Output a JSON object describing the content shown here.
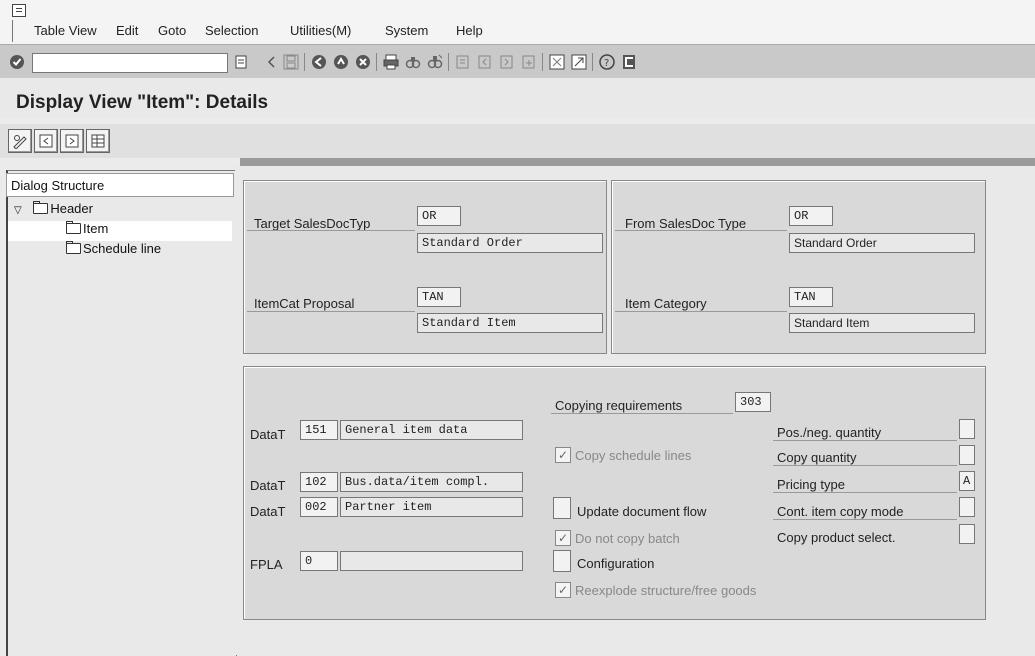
{
  "menubar": {
    "items": [
      {
        "label": "Table View",
        "u": "",
        "rest": ""
      },
      {
        "label": "Edit",
        "u": "",
        "rest": ""
      },
      {
        "label": "Goto",
        "u": "",
        "rest": ""
      },
      {
        "label": "Selection",
        "u": "",
        "rest": ""
      },
      {
        "label": "Utilities(M)",
        "u": "",
        "rest": ""
      },
      {
        "label": "System",
        "u": "",
        "rest": ""
      },
      {
        "label": "Help",
        "u": "",
        "rest": ""
      }
    ]
  },
  "toolbar": {
    "command_value": "",
    "icons": [
      "enter-icon",
      "save-icon",
      "back-icon",
      "exit-icon",
      "cancel-icon",
      "print-icon",
      "find-icon",
      "find-next-icon",
      "first-page-icon",
      "previous-page-icon",
      "next-page-icon",
      "last-page-icon",
      "create-session-icon",
      "shortcut-icon",
      "help-icon",
      "layout-menu-icon"
    ]
  },
  "page": {
    "title": "Display View \"Item\": Details"
  },
  "tree": {
    "heading": "Dialog Structure",
    "items": [
      {
        "label": "Header",
        "expanded": true
      },
      {
        "label": "Item",
        "selected": true
      },
      {
        "label": "Schedule line"
      }
    ]
  },
  "header_group": {
    "left": {
      "target_label": "Target SalesDocTyp",
      "target_value": "OR",
      "target_desc": "Standard Order",
      "proposal_label": "ItemCat Proposal",
      "proposal_value": "TAN",
      "proposal_desc": "Standard Item"
    },
    "right": {
      "from_label": "From SalesDoc Type",
      "from_value": "OR",
      "from_desc": "Standard Order",
      "category_label": "Item Category",
      "category_value": "TAN",
      "category_desc": "Standard Item"
    }
  },
  "copy_group": {
    "copying_req_label": "Copying requirements",
    "copying_req_value": "303",
    "data_rows": [
      {
        "label": "DataT",
        "code": "151",
        "desc": "General item data"
      },
      {
        "label": "DataT",
        "code": "102",
        "desc": "Bus.data/item compl."
      },
      {
        "label": "DataT",
        "code": "002",
        "desc": "Partner item"
      }
    ],
    "fpla_label": "FPLA",
    "fpla_value": "0",
    "fpla_desc": "",
    "checkboxes": [
      {
        "label": "Copy schedule lines",
        "checked": true,
        "enabled": false
      },
      {
        "label": "Update document flow",
        "checked": false,
        "enabled": true
      },
      {
        "label": "Do not copy batch",
        "checked": true,
        "enabled": false
      },
      {
        "label": "Configuration",
        "checked": false,
        "enabled": true
      },
      {
        "label": "Reexplode structure/free goods",
        "checked": true,
        "enabled": false
      }
    ],
    "right_fields": [
      {
        "label": "Pos./neg. quantity",
        "value": ""
      },
      {
        "label": "Copy quantity",
        "value": ""
      },
      {
        "label": "Pricing type",
        "value": "A"
      },
      {
        "label": "Cont. item copy mode",
        "value": ""
      },
      {
        "label": "Copy product select.",
        "value": ""
      }
    ]
  }
}
